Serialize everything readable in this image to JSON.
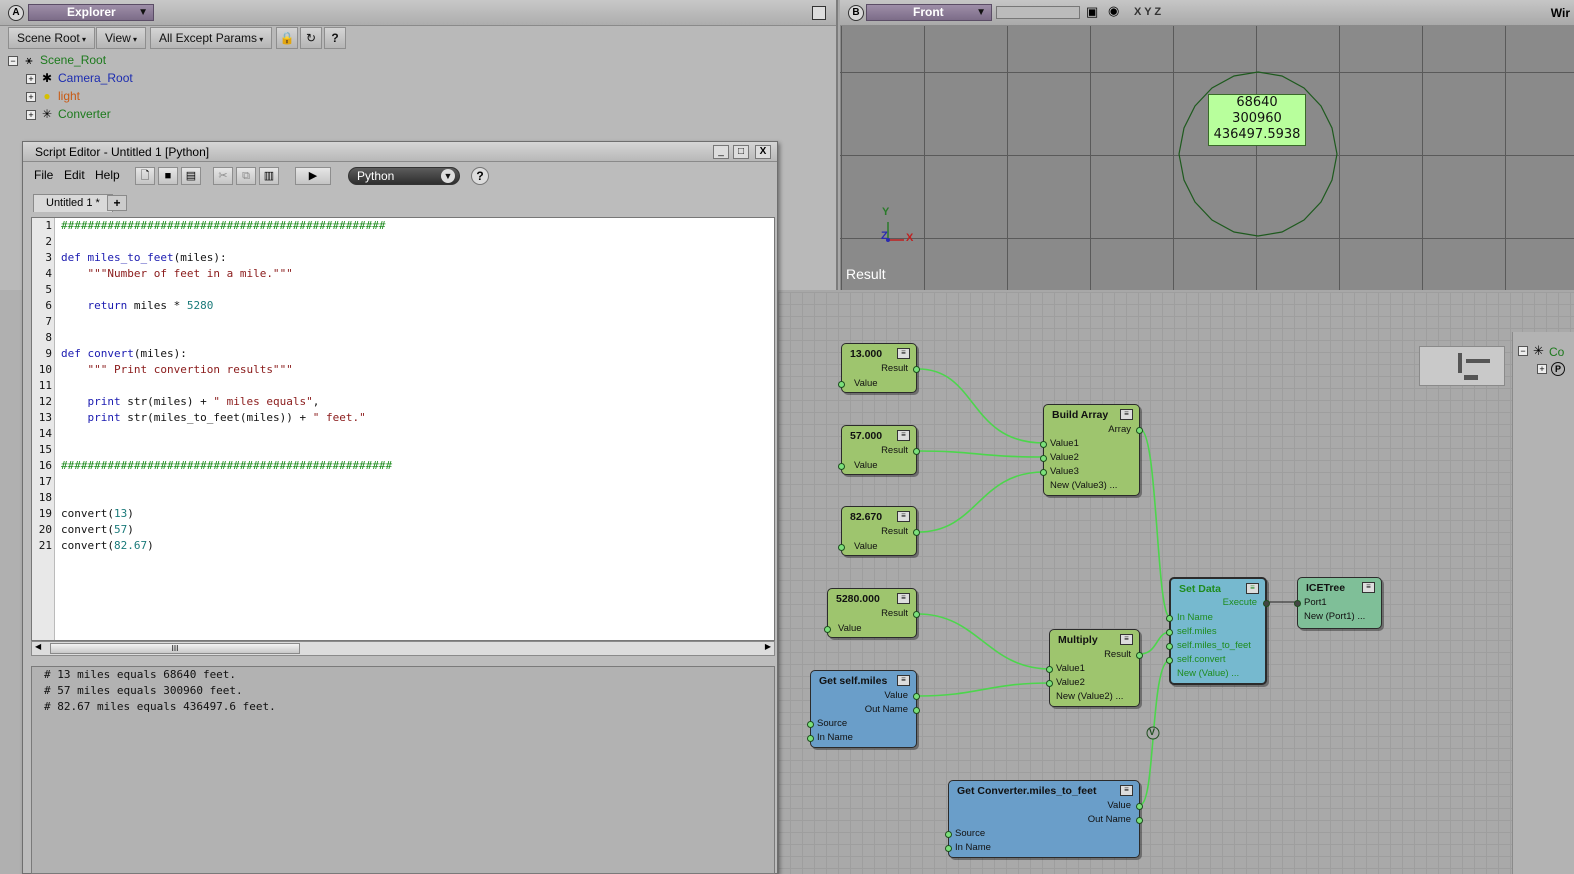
{
  "explorer": {
    "pane_letter": "A",
    "title": "Explorer",
    "toolbar": [
      "Scene Root",
      "View",
      "All Except Params"
    ],
    "tree": [
      {
        "label": "Scene_Root",
        "color": "#1d7a1d"
      },
      {
        "label": "Camera_Root",
        "color": "#1c2cb0"
      },
      {
        "label": "light",
        "color": "#c85a14"
      },
      {
        "label": "Converter",
        "color": "#1d7a1d"
      }
    ]
  },
  "viewport": {
    "pane_letter": "B",
    "view": "Front",
    "axes_label": "X Y Z",
    "right_label": "Wir",
    "annotation": [
      "68640",
      "300960",
      "436497.5938"
    ],
    "overlay": "Result",
    "axis_y": "Y",
    "axis_z": "Z",
    "axis_x": "X"
  },
  "script_editor": {
    "title": "Script Editor - Untitled 1  [Python]",
    "menu": [
      "File",
      "Edit",
      "Help"
    ],
    "language": "Python",
    "tab": "Untitled 1 *",
    "tab_add": "+",
    "scroll_thumb": "III",
    "code_lines": [
      "#################################################",
      "",
      "def miles_to_feet(miles):",
      "    \"\"\"Number of feet in a mile.\"\"\"",
      "",
      "    return miles * 5280",
      "",
      "",
      "def convert(miles):",
      "    \"\"\" Print convertion results\"\"\"",
      "",
      "    print str(miles) + \" miles equals\",",
      "    print str(miles_to_feet(miles)) + \" feet.\"",
      "",
      "",
      "##################################################",
      "",
      "",
      "convert(13)",
      "convert(57)",
      "convert(82.67)"
    ],
    "output_lines": [
      "# 13 miles equals 68640 feet.",
      "# 57 miles equals 300960 feet.",
      "# 82.67 miles equals 436497.6 feet."
    ]
  },
  "ice_tree": {
    "nodes": {
      "c13": {
        "title": "13.000",
        "outputs": [
          "Result"
        ],
        "inputs": [
          "Value"
        ]
      },
      "c57": {
        "title": "57.000",
        "outputs": [
          "Result"
        ],
        "inputs": [
          "Value"
        ]
      },
      "c82": {
        "title": "82.670",
        "outputs": [
          "Result"
        ],
        "inputs": [
          "Value"
        ]
      },
      "c5280": {
        "title": "5280.000",
        "outputs": [
          "Result"
        ],
        "inputs": [
          "Value"
        ]
      },
      "build_array": {
        "title": "Build Array",
        "outputs": [
          "Array"
        ],
        "inputs": [
          "Value1",
          "Value2",
          "Value3",
          "New (Value3) ..."
        ]
      },
      "multiply": {
        "title": "Multiply",
        "outputs": [
          "Result"
        ],
        "inputs": [
          "Value1",
          "Value2",
          "New (Value2) ..."
        ]
      },
      "get_miles": {
        "title": "Get self.miles",
        "outputs": [
          "Value",
          "Out Name"
        ],
        "inputs": [
          "Source",
          "In Name"
        ]
      },
      "set_data": {
        "title": "Set Data",
        "outputs": [
          "Execute"
        ],
        "inputs": [
          "In Name",
          "self.miles",
          "self.miles_to_feet",
          "self.convert",
          "New (Value) ..."
        ]
      },
      "icetree": {
        "title": "ICETree",
        "inputs": [
          "Port1",
          "New (Port1) ..."
        ]
      },
      "get_converter": {
        "title": "Get Converter.miles_to_feet",
        "outputs": [
          "Value",
          "Out Name"
        ],
        "inputs": [
          "Source",
          "In Name"
        ]
      }
    },
    "junction_label": "V",
    "side_label": "Co"
  }
}
